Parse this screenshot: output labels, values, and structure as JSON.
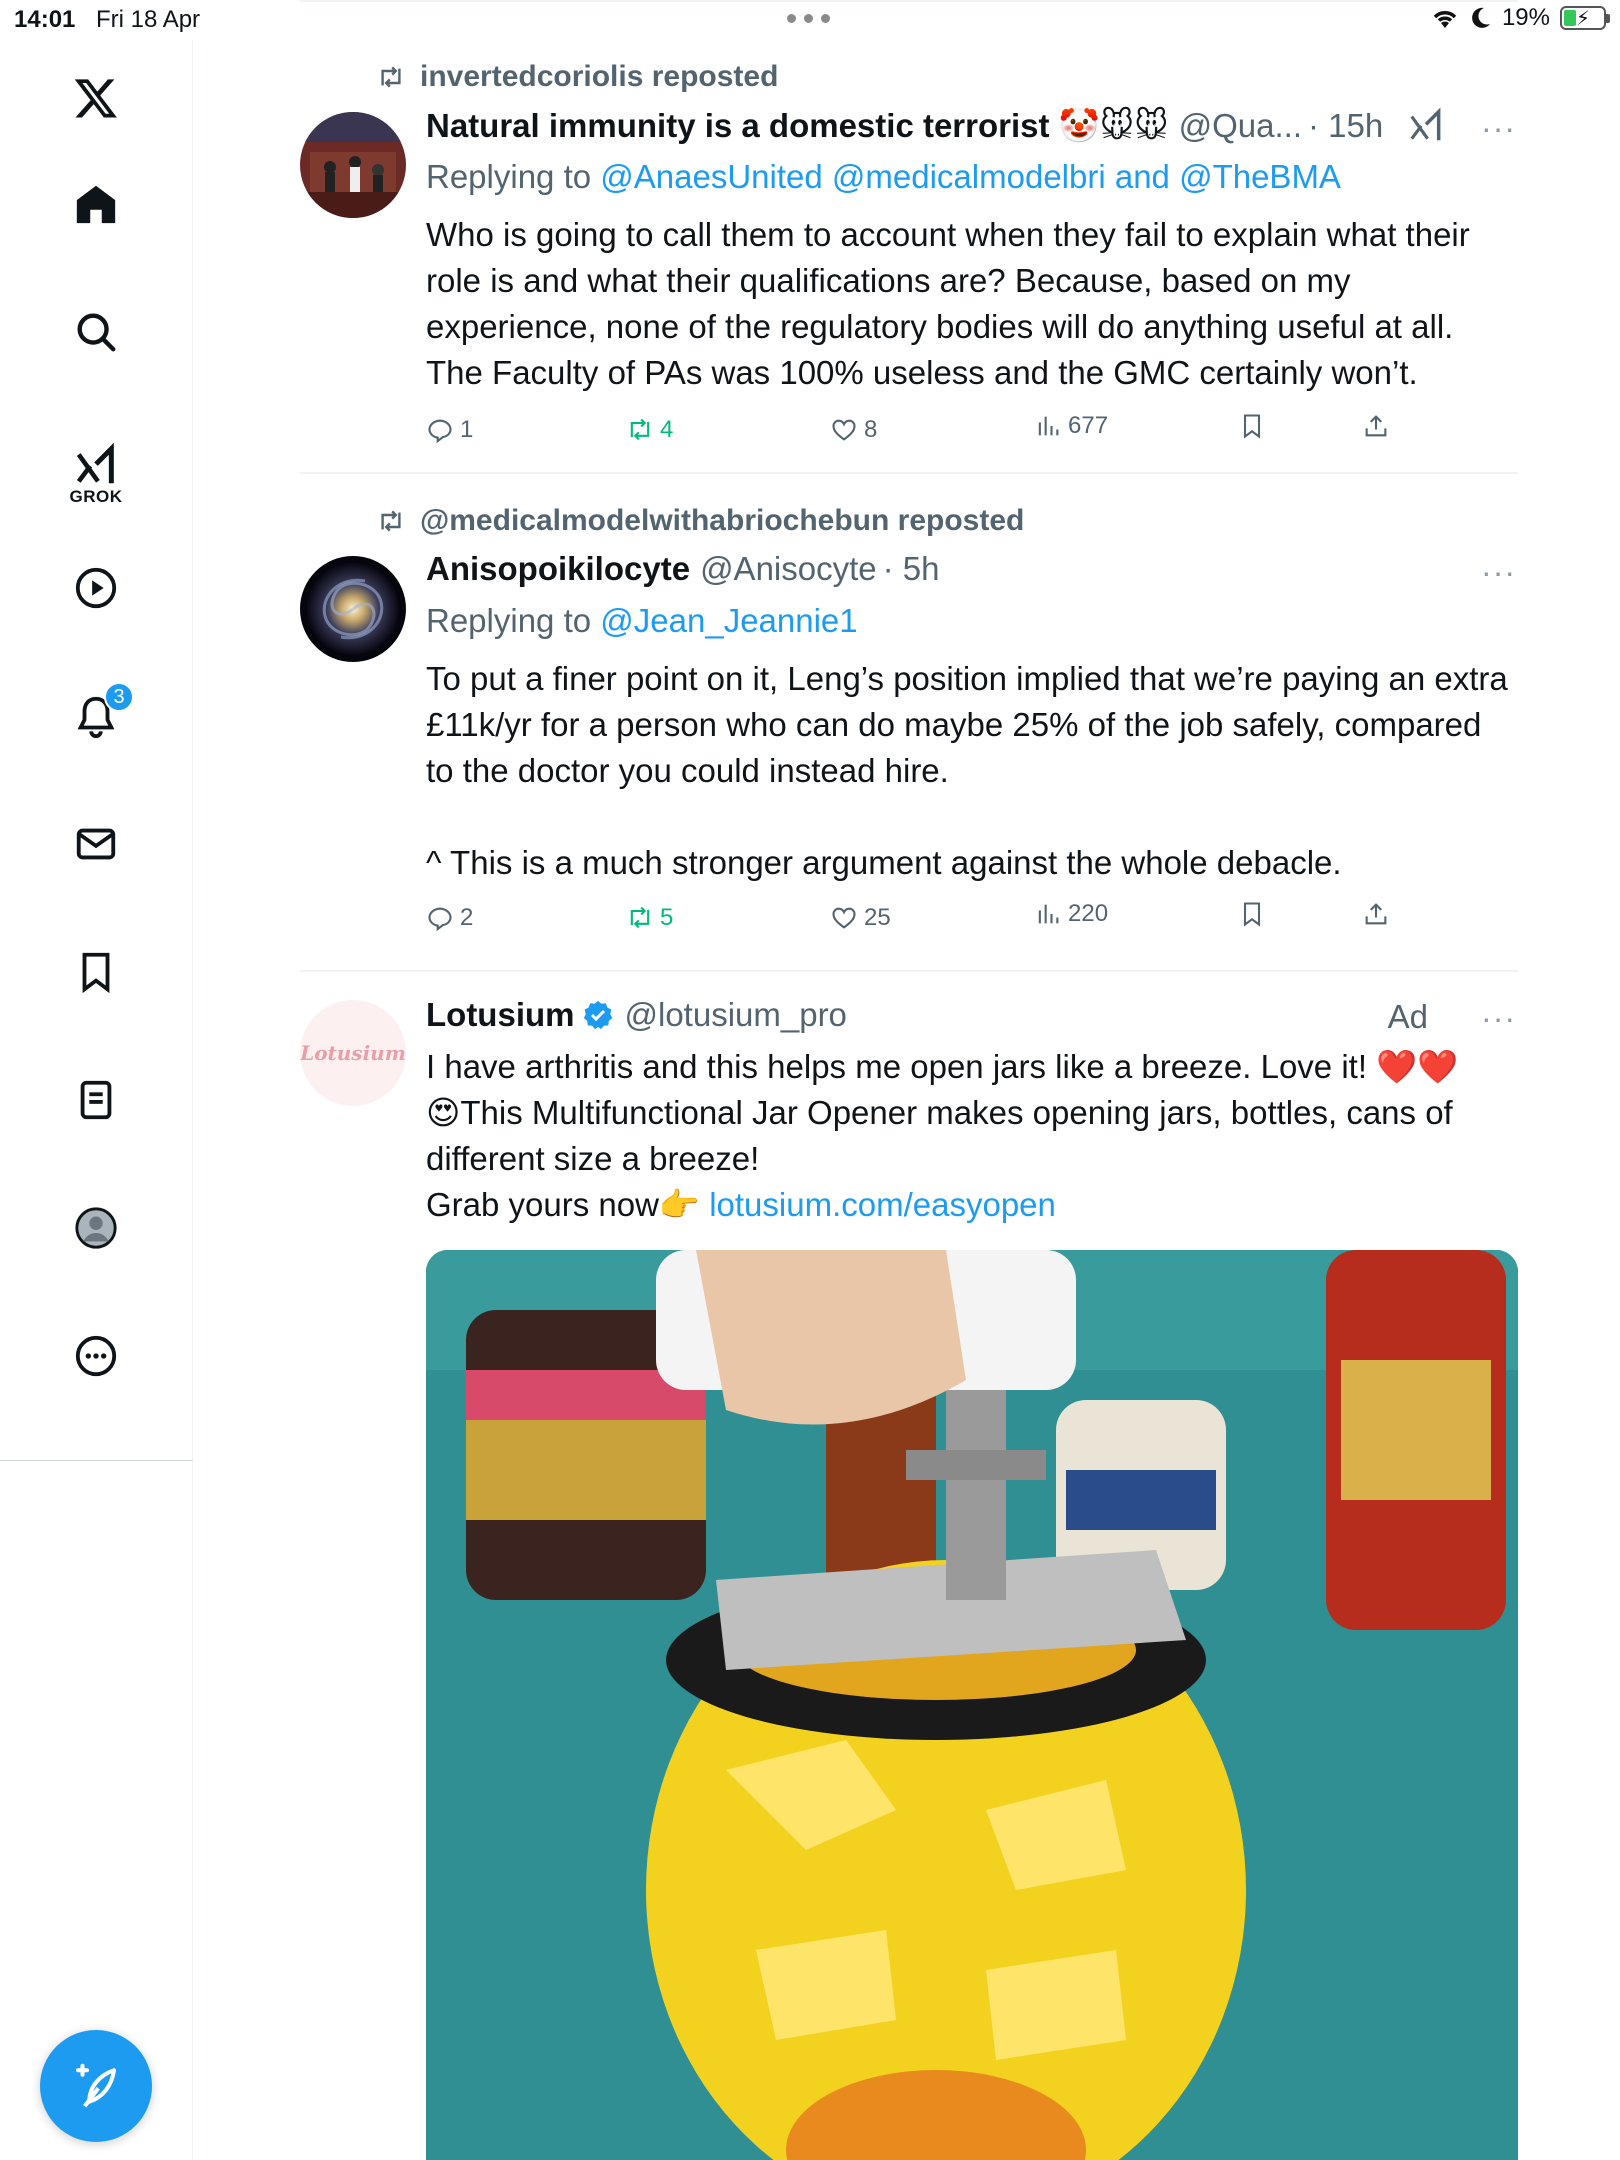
{
  "status_bar": {
    "time": "14:01",
    "date": "Fri 18 Apr",
    "battery": "19%"
  },
  "sidebar": {
    "grok_label": "GROK",
    "notifications_badge": "3",
    "items": [
      "x-logo-icon",
      "home-icon",
      "search-icon",
      "grok-icon",
      "video-icon",
      "notifications-icon",
      "messages-icon",
      "bookmarks-icon",
      "lists-icon",
      "profile-icon",
      "more-icon"
    ]
  },
  "tweets": [
    {
      "repost_by": "invertedcoriolis reposted",
      "name": "Natural immunity is a domestic terrorist 🤡🐭🐭",
      "handle": "@Qua...",
      "time": "· 15h",
      "reply_prefix": "Replying to",
      "reply_users": "@AnaesUnited @medicalmodelbri and @TheBMA",
      "text": "Who is going to call them to account when they fail to explain what their role is and what their qualifications are? Because, based on my experience, none of the regulatory bodies will do anything useful at all. The Faculty of PAs was 100% useless and the GMC certainly won’t.",
      "replies": "1",
      "reposts": "4",
      "likes": "8",
      "views": "677"
    },
    {
      "repost_by": "@medicalmodelwithabriochebun reposted",
      "name": "Anisopoikilocyte",
      "handle": "@Anisocyte",
      "time": "· 5h",
      "reply_prefix": "Replying to",
      "reply_users": "@Jean_Jeannie1",
      "text_line1": "To put a finer point on it, Leng’s position implied that we’re paying an extra £11k/yr for a person who can do maybe 25% of the job safely, compared to the doctor you could instead hire.",
      "text_line2": "^ This is a much stronger argument against the whole debacle.",
      "replies": "2",
      "reposts": "5",
      "likes": "25",
      "views": "220"
    },
    {
      "name": "Lotusium",
      "handle": "@lotusium_pro",
      "ad_label": "Ad",
      "avatar_text": "Lotusium",
      "text_part1": "I have arthritis and this helps me open jars like a breeze. Love it! ❤️❤️",
      "text_part2": "😍This Multifunctional Jar Opener makes opening jars, bottles, cans of different size a breeze!",
      "text_part3": "Grab yours now👉 ",
      "link": "lotusium.com/easyopen"
    }
  ],
  "colors": {
    "accent": "#1d9bf0",
    "repost_green": "#00ba7c",
    "secondary_text": "#536471"
  }
}
